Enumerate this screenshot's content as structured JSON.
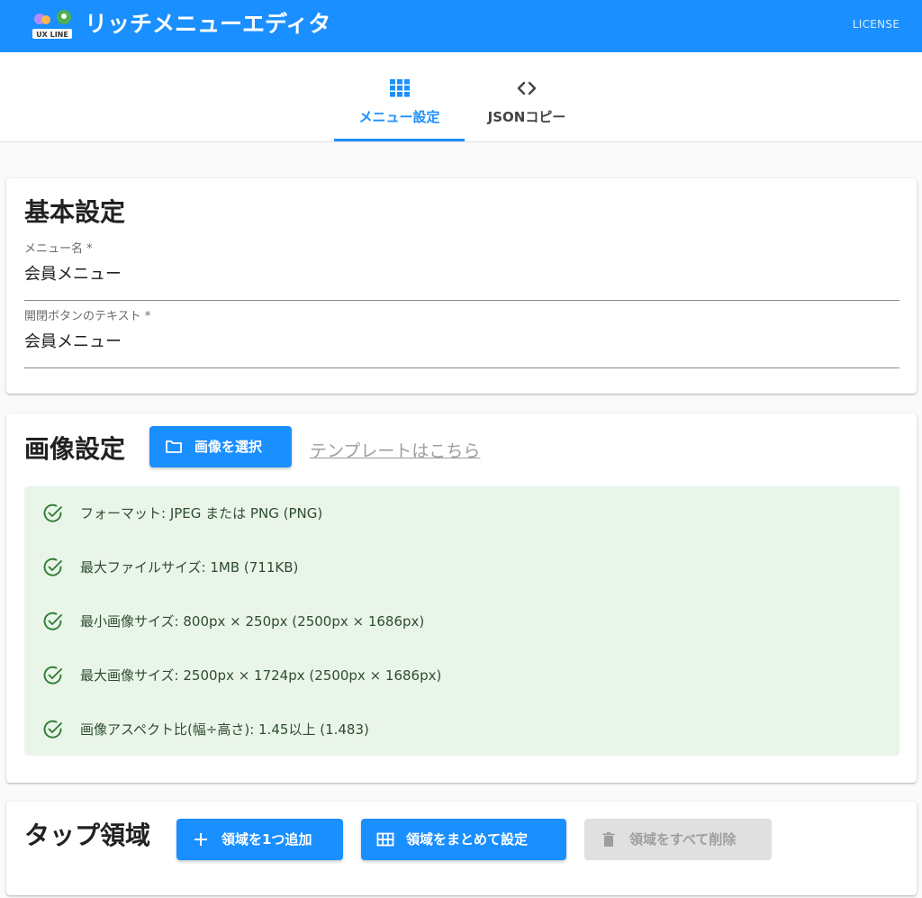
{
  "app": {
    "title": "リッチメニューエディタ",
    "logo_text": "UX LINE",
    "license_label": "LICENSE"
  },
  "tabs": [
    {
      "label": "メニュー設定",
      "icon": "grid-icon",
      "active": true
    },
    {
      "label": "JSONコピー",
      "icon": "code-icon",
      "active": false
    }
  ],
  "basic": {
    "title": "基本設定",
    "menu_name": {
      "label": "メニュー名 *",
      "value": "会員メニュー"
    },
    "button_text": {
      "label": "開閉ボタンのテキスト *",
      "value": "会員メニュー"
    }
  },
  "image": {
    "title": "画像設定",
    "select_button": "画像を選択",
    "template_link": "テンプレートはこちら",
    "checks": [
      "フォーマット: JPEG または PNG (PNG)",
      "最大ファイルサイズ: 1MB (711KB)",
      "最小画像サイズ: 800px × 250px (2500px × 1686px)",
      "最大画像サイズ: 2500px × 1724px (2500px × 1686px)",
      "画像アスペクト比(幅÷高さ): 1.45以上 (1.483)"
    ]
  },
  "tap": {
    "title": "タップ領域",
    "add_button": "領域を1つ追加",
    "bulk_button": "領域をまとめて設定",
    "delete_button": "領域をすべて削除"
  },
  "colors": {
    "primary": "#1a8fff",
    "success_bg": "#eaf5ea",
    "success_icon": "#2e7d32",
    "disabled": "#e0e0e0"
  }
}
